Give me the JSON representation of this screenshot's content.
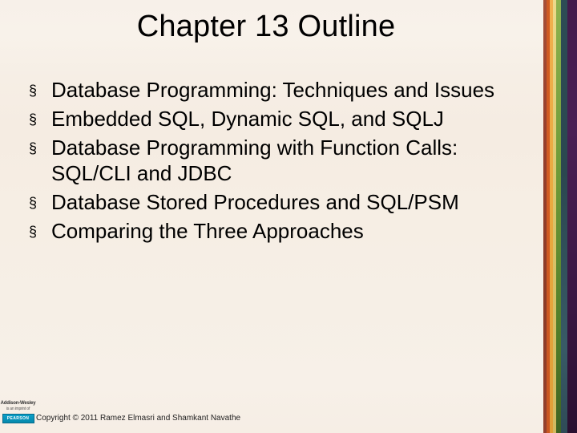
{
  "title": "Chapter 13 Outline",
  "bullets": [
    "Database Programming: Techniques and Issues",
    "Embedded SQL, Dynamic SQL, and SQLJ",
    "Database Programming with Function Calls: SQL/CLI and JDBC",
    "Database Stored Procedures and SQL/PSM",
    "Comparing the Three Approaches"
  ],
  "footer": {
    "copyright": "Copyright © 2011 Ramez Elmasri and Shamkant Navathe",
    "publisher_top": "Addison-Wesley",
    "publisher_sub": "is an imprint of",
    "publisher_brand": "PEARSON"
  },
  "decor": {
    "stripe_colors": [
      "#94402d",
      "#d35c23",
      "#e9a93f",
      "#d9c368",
      "#6e9a38",
      "#2b4750",
      "#4a1f54"
    ]
  }
}
